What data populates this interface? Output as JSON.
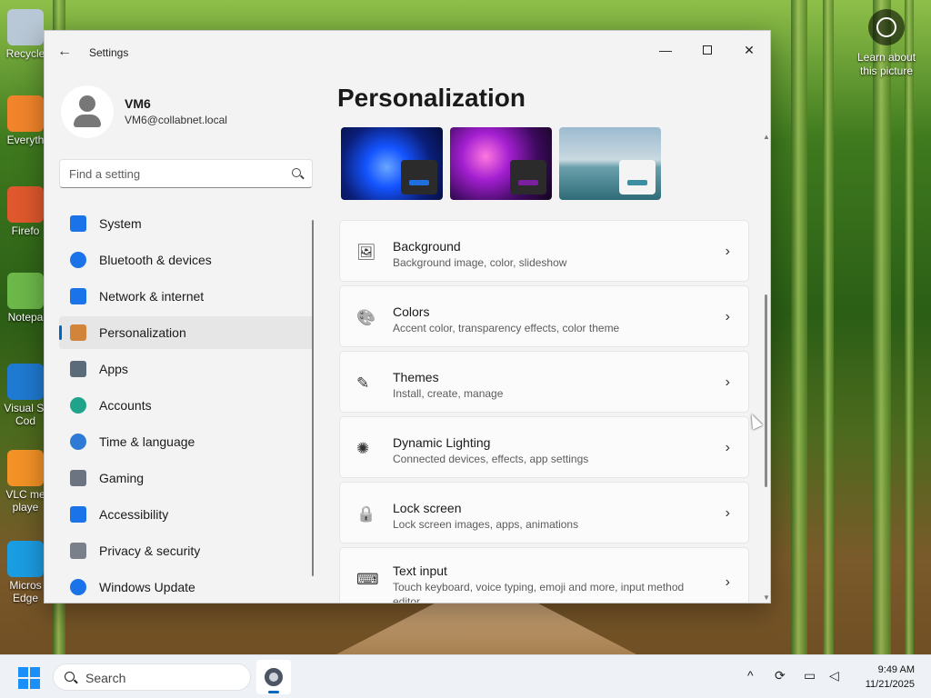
{
  "desktop": {
    "icons": [
      {
        "label": "Recycle",
        "color": "#b9c8d6"
      },
      {
        "label": "Everyth",
        "color": "#f2842b"
      },
      {
        "label": "Firefo",
        "color": "#e0582d"
      },
      {
        "label": "Notepa",
        "color": "#6db84a"
      },
      {
        "label": "Visual St\nCod",
        "color": "#1f7ad1"
      },
      {
        "label": "VLC me\nplaye",
        "color": "#f39226"
      },
      {
        "label": "Micros\nEdge",
        "color": "#1b9de2"
      }
    ],
    "learn_label": "Learn about this picture"
  },
  "window": {
    "title": "Settings",
    "controls": {
      "minimize": "—",
      "close": "✕"
    }
  },
  "user": {
    "name": "VM6",
    "email": "VM6@collabnet.local"
  },
  "search": {
    "placeholder": "Find a setting"
  },
  "nav": {
    "items": [
      {
        "label": "System",
        "icon": "system-icon",
        "color": "#1a73e8",
        "active": false
      },
      {
        "label": "Bluetooth & devices",
        "icon": "bluetooth-icon",
        "color": "#1a73e8",
        "active": false
      },
      {
        "label": "Network & internet",
        "icon": "wifi-icon",
        "color": "#1a73e8",
        "active": false
      },
      {
        "label": "Personalization",
        "icon": "brush-icon",
        "color": "#d1843a",
        "active": true
      },
      {
        "label": "Apps",
        "icon": "apps-icon",
        "color": "#5b6b7a",
        "active": false
      },
      {
        "label": "Accounts",
        "icon": "accounts-icon",
        "color": "#1fa38a",
        "active": false
      },
      {
        "label": "Time & language",
        "icon": "time-language-icon",
        "color": "#2e7bd6",
        "active": false
      },
      {
        "label": "Gaming",
        "icon": "gaming-icon",
        "color": "#6b7480",
        "active": false
      },
      {
        "label": "Accessibility",
        "icon": "accessibility-icon",
        "color": "#1a73e8",
        "active": false
      },
      {
        "label": "Privacy & security",
        "icon": "shield-icon",
        "color": "#7a8089",
        "active": false
      },
      {
        "label": "Windows Update",
        "icon": "windows-update-icon",
        "color": "#1a73e8",
        "active": false
      }
    ]
  },
  "main": {
    "title": "Personalization",
    "themes": [
      {
        "name": "theme-blue-bloom",
        "bar_color": "#1e6fe0"
      },
      {
        "name": "theme-purple-glow",
        "bar_color": "#7a1f9e"
      },
      {
        "name": "theme-lake",
        "bar_color": "#3b8fa0"
      }
    ],
    "cards": [
      {
        "title": "Background",
        "subtitle": "Background image, color, slideshow",
        "icon": "image-icon"
      },
      {
        "title": "Colors",
        "subtitle": "Accent color, transparency effects, color theme",
        "icon": "palette-icon"
      },
      {
        "title": "Themes",
        "subtitle": "Install, create, manage",
        "icon": "pen-icon"
      },
      {
        "title": "Dynamic Lighting",
        "subtitle": "Connected devices, effects, app settings",
        "icon": "lighting-icon"
      },
      {
        "title": "Lock screen",
        "subtitle": "Lock screen images, apps, animations",
        "icon": "lock-screen-icon"
      },
      {
        "title": "Text input",
        "subtitle": "Touch keyboard, voice typing, emoji and more, input method editor",
        "icon": "keyboard-icon"
      }
    ],
    "chevron": "›"
  },
  "taskbar": {
    "search_label": "Search",
    "time": "9:49 AM",
    "date": "11/21/2025",
    "tray_chevron": "^"
  }
}
